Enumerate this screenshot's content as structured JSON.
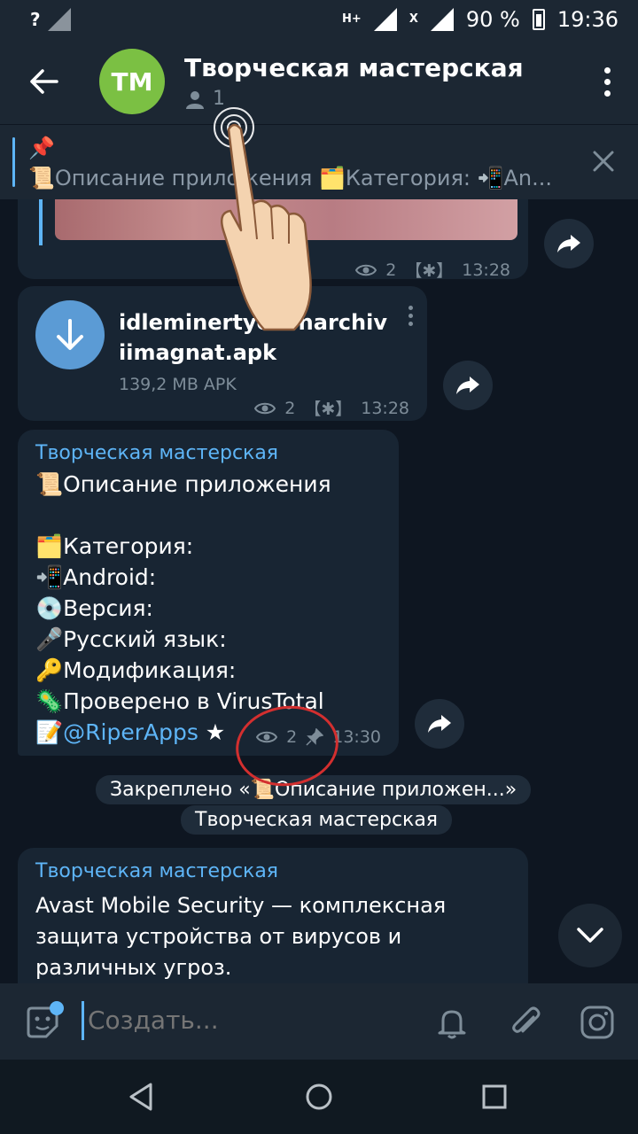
{
  "status_bar": {
    "network": "H+",
    "network2": "X",
    "battery": "90 %",
    "time": "19:36"
  },
  "header": {
    "avatar_initials": "TM",
    "title": "Творческая мастерская",
    "members": "1"
  },
  "pinned": {
    "emoji": "📌",
    "text": "📜Описание приложения 🗂️Категория: 📲An..."
  },
  "messages": {
    "m1": {
      "views": "2",
      "signature": "【✱】",
      "time": "13:28"
    },
    "m2": {
      "file_name": "idleminertycoonarchiviimagnat.apk",
      "file_size": "139,2 MB APK",
      "views": "2",
      "signature": "【✱】",
      "time": "13:28"
    },
    "m3": {
      "sender": "Творческая мастерская",
      "lines": [
        "📜Описание приложения",
        "",
        "🗂️Категория:",
        "📲Android:",
        "💿Версия:",
        "🎤Русский язык:",
        "🔑Модификация:",
        "🦠Проверено в VirusTotal"
      ],
      "link_prefix": "📝",
      "link": "@RiperApps",
      "link_suffix": " ★",
      "views": "2",
      "time": "13:30"
    },
    "service_line1": "Закреплено «📜Описание приложен...»",
    "service_line2": "Творческая мастерская",
    "m4": {
      "sender": "Творческая мастерская",
      "lines": [
        "Avast Mobile Security — комплексная",
        "защита устройства от вирусов и",
        "различных угроз."
      ]
    }
  },
  "compose": {
    "placeholder": "Создать..."
  },
  "colors": {
    "background": "#0e1621",
    "bar": "#1c2733",
    "bubble": "#182533",
    "accent": "#5eb5f7",
    "avatar": "#7bc043",
    "annotation": "#d32f2f"
  },
  "icons": [
    "back-arrow-icon",
    "person-icon",
    "more-vert-icon",
    "pin-icon",
    "close-icon",
    "eye-icon",
    "forward-icon",
    "download-icon",
    "pinned-icon",
    "chevron-down-icon",
    "sticker-icon",
    "bell-icon",
    "attach-icon",
    "camera-icon",
    "nav-back-icon",
    "nav-home-icon",
    "nav-recents-icon"
  ]
}
